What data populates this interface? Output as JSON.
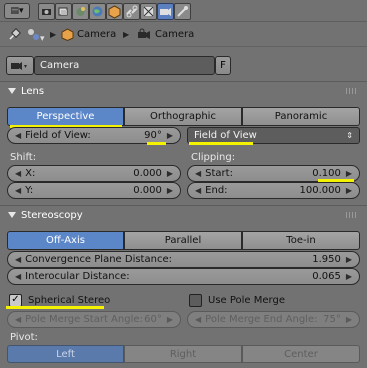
{
  "context": {
    "path_object": "Camera",
    "path_data": "Camera",
    "datablock_name": "Camera",
    "fake_user": "F"
  },
  "icons": {
    "toolbar": [
      "render-icon",
      "render-layers-icon",
      "scene-icon",
      "world-icon",
      "object-icon",
      "constraint-icon",
      "modifier-icon",
      "camera-data-icon"
    ],
    "active_tab": "camera-data-icon"
  },
  "lens": {
    "title": "Lens",
    "types": [
      "Perspective",
      "Orthographic",
      "Panoramic"
    ],
    "active_type": "Perspective",
    "fov_label": "Field of View:",
    "fov_value": "90°",
    "lens_unit": "Field of View",
    "shift_label": "Shift:",
    "shift_x_label": "X:",
    "shift_x": "0.000",
    "shift_y_label": "Y:",
    "shift_y": "0.000",
    "clipping_label": "Clipping:",
    "clip_start_label": "Start:",
    "clip_start": "0.100",
    "clip_end_label": "End:",
    "clip_end": "100.000"
  },
  "stereoscopy": {
    "title": "Stereoscopy",
    "modes": [
      "Off-Axis",
      "Parallel",
      "Toe-in"
    ],
    "active_mode": "Off-Axis",
    "convergence_label": "Convergence Plane Distance:",
    "convergence": "1.950",
    "interocular_label": "Interocular Distance:",
    "interocular": "0.065",
    "spherical_label": "Spherical Stereo",
    "spherical_checked": true,
    "pole_merge_label": "Use Pole Merge",
    "pole_merge_checked": false,
    "pole_start_label": "Pole Merge Start Angle:",
    "pole_start": "60°",
    "pole_end_label": "Pole Merge End Angle:",
    "pole_end": "75°",
    "pivot_label": "Pivot:",
    "pivots": [
      "Left",
      "Right",
      "Center"
    ],
    "active_pivot": "Left"
  },
  "colors": {
    "highlight": "#f4f200",
    "active": "#5b86c8"
  }
}
